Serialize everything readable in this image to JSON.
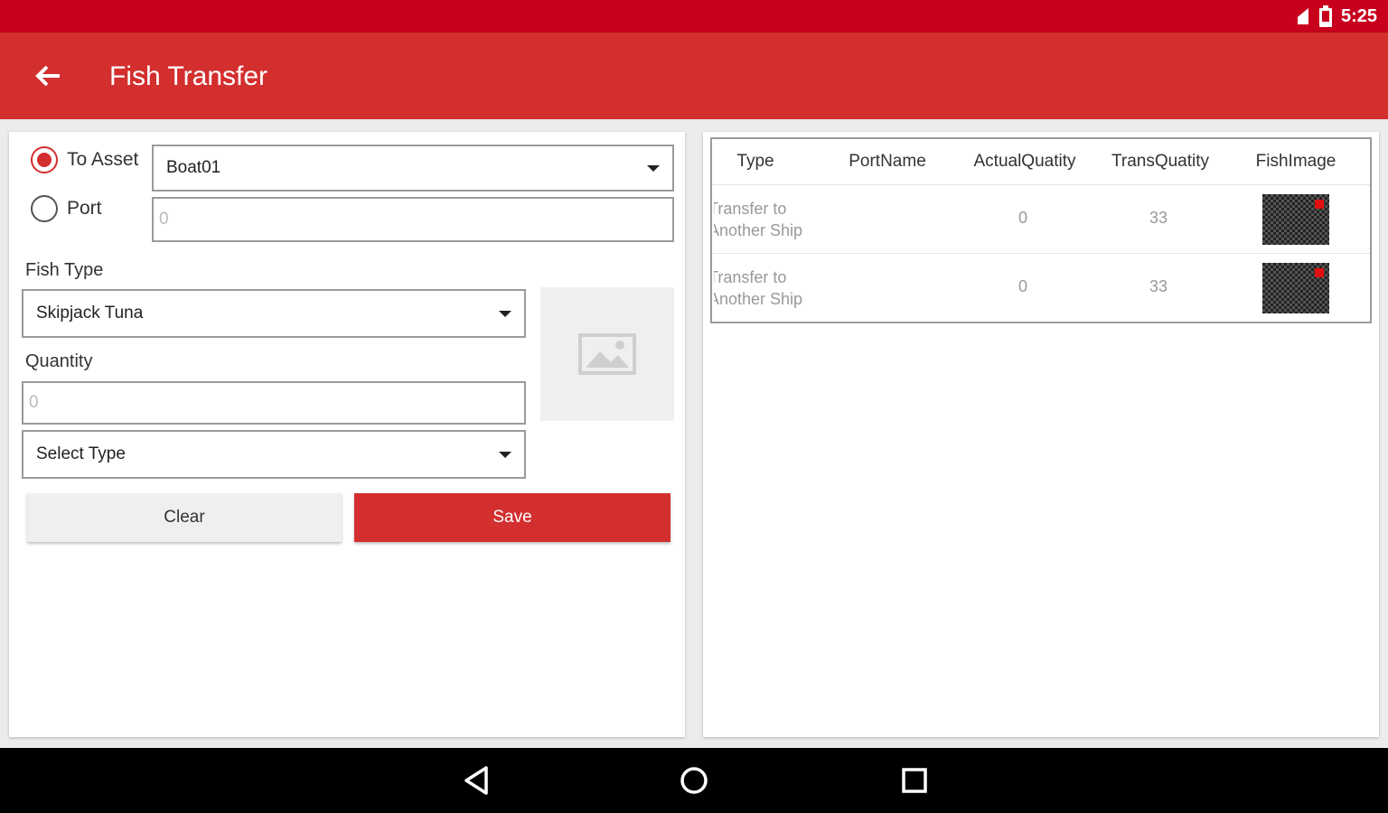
{
  "status_bar": {
    "time": "5:25"
  },
  "app_bar": {
    "title": "Fish Transfer"
  },
  "form": {
    "radio_to_asset": "To Asset",
    "radio_port": "Port",
    "asset_select": "Boat01",
    "port_input": "0",
    "fish_type_label": "Fish Type",
    "fish_type_select": "Skipjack Tuna",
    "quantity_label": "Quantity",
    "quantity_input": "0",
    "type_select": "Select Type",
    "clear_label": "Clear",
    "save_label": "Save"
  },
  "table": {
    "headers": [
      "Type",
      "PortName",
      "ActualQuatity",
      "TransQuatity",
      "FishImage"
    ],
    "rows": [
      {
        "type_line1": "Transfer to",
        "type_line2": "Another Ship",
        "port": "",
        "actual": "0",
        "trans": "33"
      },
      {
        "type_line1": "Transfer to",
        "type_line2": "Another Ship",
        "port": "",
        "actual": "0",
        "trans": "33"
      }
    ]
  },
  "colors": {
    "accent": "#d32f2f",
    "status_bar": "#c8001e"
  },
  "icons": {
    "back": "arrow-back-icon",
    "dropdown": "caret-down-icon",
    "image": "image-placeholder-icon",
    "nav_back": "triangle-back-icon",
    "nav_home": "circle-home-icon",
    "nav_recent": "square-recent-icon"
  }
}
